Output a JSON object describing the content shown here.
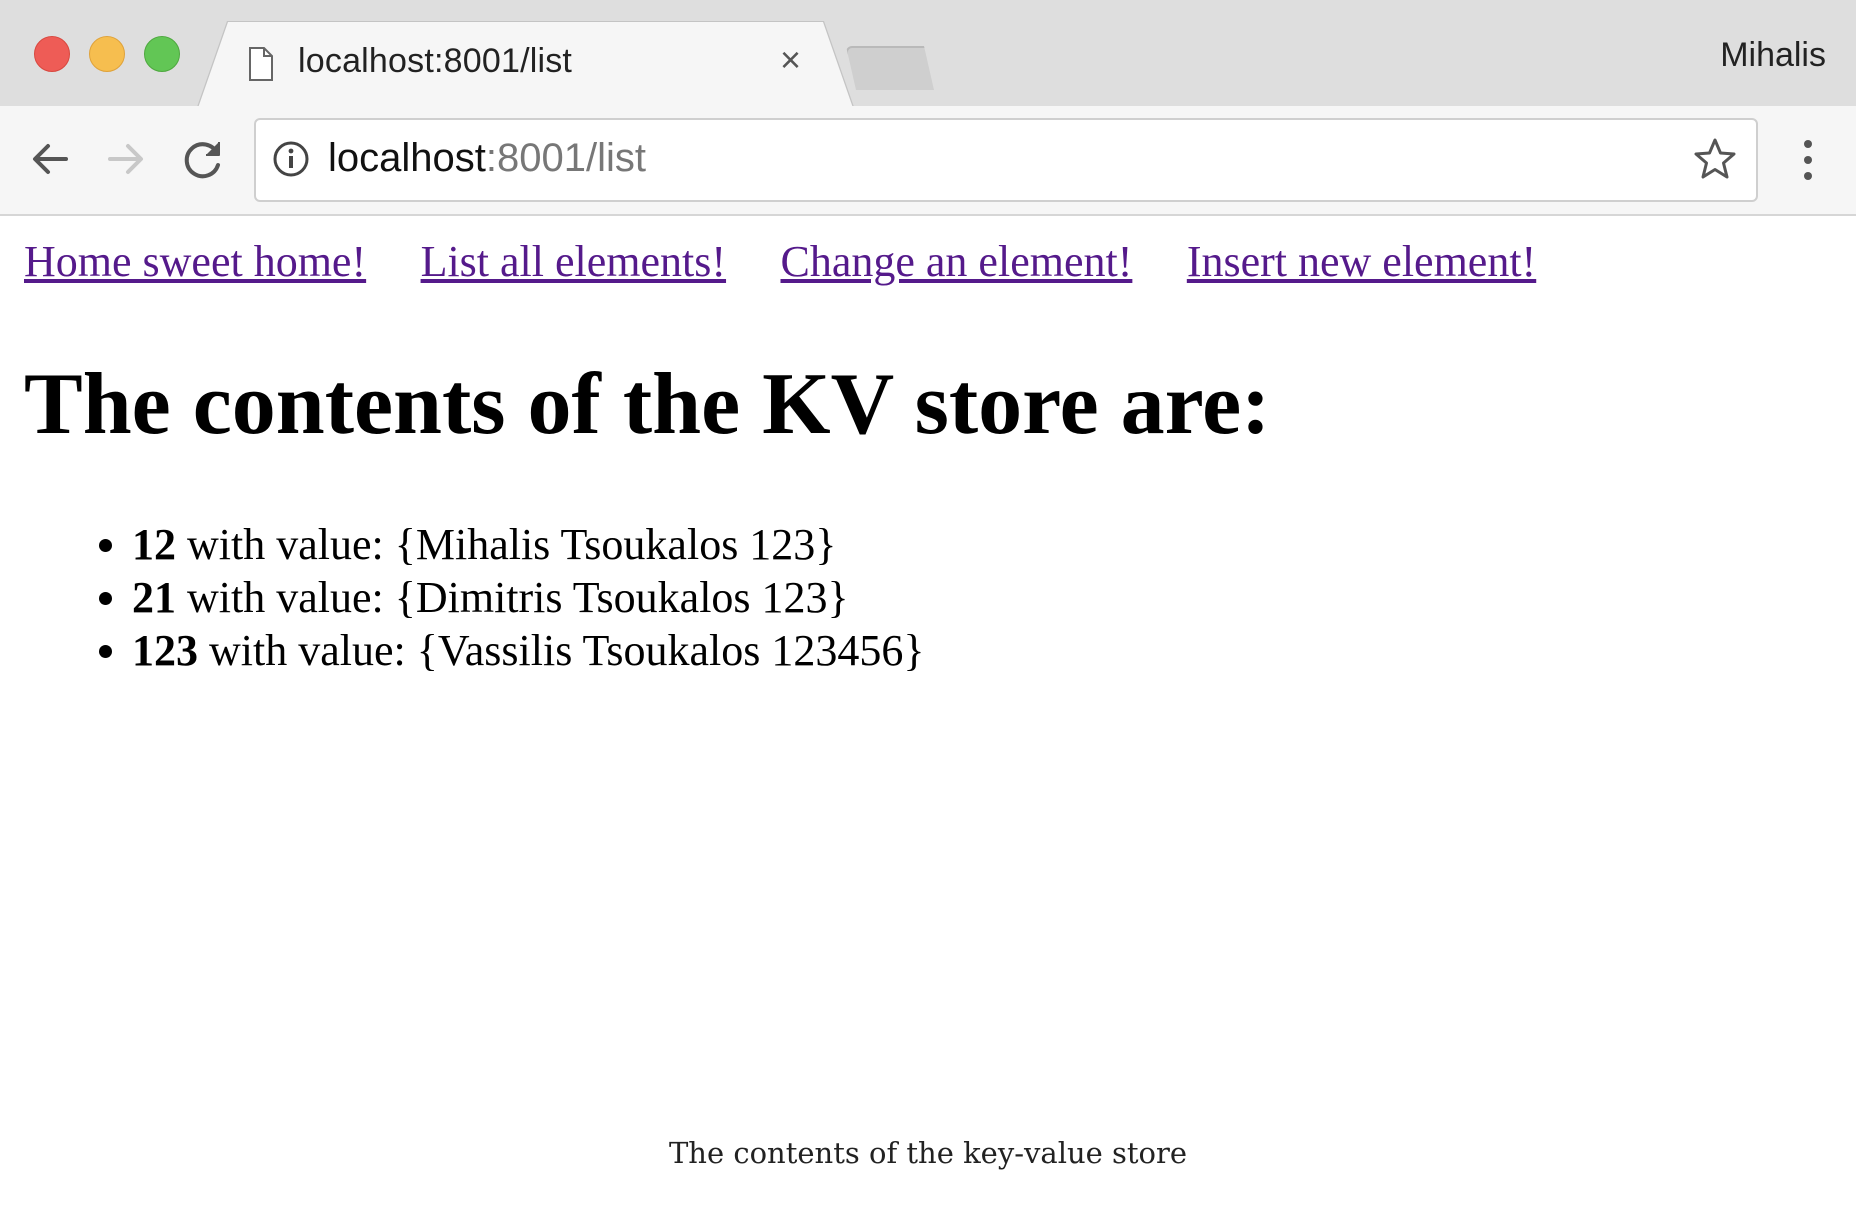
{
  "window": {
    "profile_name": "Mihalis",
    "tab": {
      "title": "localhost:8001/list"
    }
  },
  "toolbar": {
    "url_host": "localhost",
    "url_rest": ":8001/list"
  },
  "page": {
    "nav_links": [
      {
        "label": "Home sweet home!"
      },
      {
        "label": "List all elements!"
      },
      {
        "label": "Change an element!"
      },
      {
        "label": "Insert new element!"
      }
    ],
    "heading": "The contents of the KV store are:",
    "items": [
      {
        "key": "12",
        "text": " with value: {Mihalis Tsoukalos 123}"
      },
      {
        "key": "21",
        "text": " with value: {Dimitris Tsoukalos 123}"
      },
      {
        "key": "123",
        "text": " with value: {Vassilis Tsoukalos 123456}"
      }
    ]
  },
  "caption": "The contents of the key-value store",
  "colors": {
    "link": "#551a8b",
    "close_button": "#ee5c56",
    "minimize_button": "#f6be4f",
    "zoom_button": "#62c655"
  },
  "icons": [
    "page-icon",
    "close-icon",
    "back-arrow-icon",
    "forward-arrow-icon",
    "reload-icon",
    "info-icon",
    "star-icon",
    "more-menu-icon"
  ]
}
